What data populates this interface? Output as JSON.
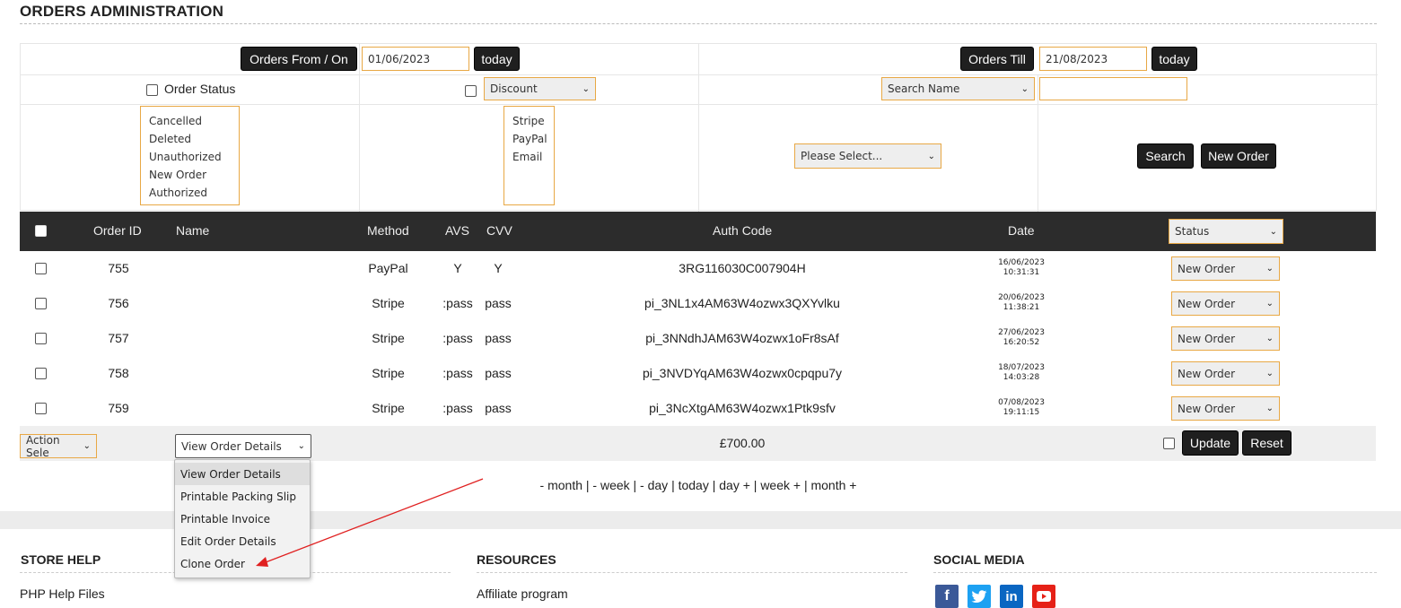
{
  "title": "ORDERS ADMINISTRATION",
  "filters": {
    "orders_from_label": "Orders From / On",
    "orders_from_value": "01/06/2023",
    "today_label": "today",
    "orders_till_label": "Orders Till",
    "orders_till_value": "21/08/2023",
    "order_status_label": "Order Status",
    "discount_select": "Discount",
    "search_name_select": "Search Name",
    "search_text_value": "",
    "status_options": [
      "Cancelled",
      "Deleted",
      "Unauthorized",
      "New Order",
      "Authorized"
    ],
    "method_options": [
      "Stripe",
      "PayPal",
      "Email"
    ],
    "please_select": "Please Select...",
    "search_button": "Search",
    "new_order_button": "New Order"
  },
  "table": {
    "headers": {
      "order_id": "Order ID",
      "name": "Name",
      "method": "Method",
      "avs": "AVS",
      "cvv": "CVV",
      "auth_code": "Auth Code",
      "date": "Date",
      "status_select": "Status"
    },
    "rows": [
      {
        "id": "755",
        "method": "PayPal",
        "avs": "Y",
        "cvv": "Y",
        "auth": "3RG116030C007904H",
        "date": "16/06/2023",
        "time": "10:31:31",
        "status": "New Order"
      },
      {
        "id": "756",
        "method": "Stripe",
        "avs": ":pass",
        "cvv": "pass",
        "auth": "pi_3NL1x4AM63W4ozwx3QXYvlku",
        "date": "20/06/2023",
        "time": "11:38:21",
        "status": "New Order"
      },
      {
        "id": "757",
        "method": "Stripe",
        "avs": ":pass",
        "cvv": "pass",
        "auth": "pi_3NNdhJAM63W4ozwx1oFr8sAf",
        "date": "27/06/2023",
        "time": "16:20:52",
        "status": "New Order"
      },
      {
        "id": "758",
        "method": "Stripe",
        "avs": ":pass",
        "cvv": "pass",
        "auth": "pi_3NVDYqAM63W4ozwx0cpqpu7y",
        "date": "18/07/2023",
        "time": "14:03:28",
        "status": "New Order"
      },
      {
        "id": "759",
        "method": "Stripe",
        "avs": ":pass",
        "cvv": "pass",
        "auth": "pi_3NcXtgAM63W4ozwx1Ptk9sfv",
        "date": "07/08/2023",
        "time": "19:11:15",
        "status": "New Order"
      }
    ],
    "footer": {
      "action_select": "Action Sele",
      "view_select": "View Order Details",
      "total": "£700.00",
      "update_button": "Update",
      "reset_button": "Reset"
    }
  },
  "dropdown_menu": [
    "View Order Details",
    "Printable Packing Slip",
    "Printable Invoice",
    "Edit Order Details",
    "Clone Order"
  ],
  "date_nav": "- month | - week | - day | today | day + | week + | month +",
  "footer": {
    "store_help": "STORE HELP",
    "store_help_link": "PHP Help Files",
    "resources": "RESOURCES",
    "resources_link": "Affiliate program",
    "social_media": "SOCIAL MEDIA",
    "social_icons": [
      "facebook-icon",
      "twitter-icon",
      "linkedin-icon",
      "youtube-icon"
    ]
  },
  "colors": {
    "accent_border": "#e8a845",
    "header_bg": "#2c2c2c",
    "arrow": "#e02020"
  }
}
